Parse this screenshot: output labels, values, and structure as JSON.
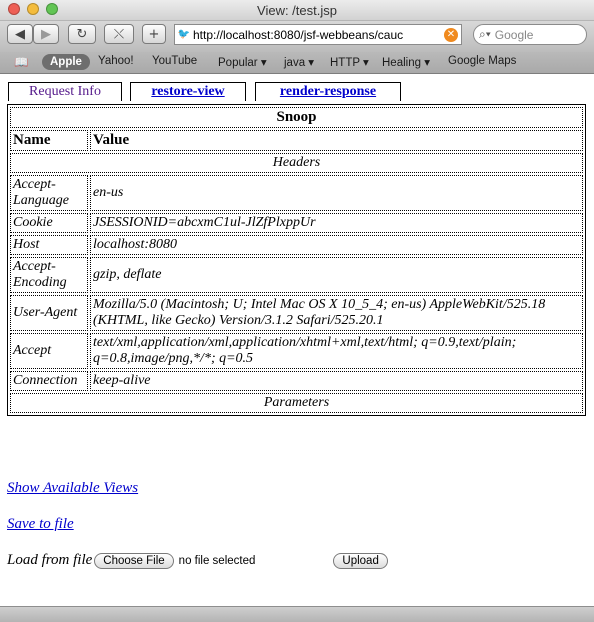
{
  "window": {
    "title": "View: /test.jsp"
  },
  "toolbar": {
    "back_icon": "back-icon",
    "forward_icon": "forward-icon",
    "url": "http://localhost:8080/jsf-webbeans/cauc",
    "search_placeholder": "Google"
  },
  "bookmarks": [
    {
      "label": "Apple"
    },
    {
      "label": "Yahoo!"
    },
    {
      "label": "YouTube"
    },
    {
      "label": "Popular ▾"
    },
    {
      "label": "java ▾"
    },
    {
      "label": "HTTP ▾"
    },
    {
      "label": "Healing ▾"
    },
    {
      "label": "Google Maps"
    }
  ],
  "tabs": [
    {
      "label": "Request Info"
    },
    {
      "label": "restore-view"
    },
    {
      "label": "render-response"
    }
  ],
  "snoop": {
    "title": "Snoop",
    "col_name": "Name",
    "col_value": "Value",
    "headers_label": "Headers",
    "parameters_label": "Parameters",
    "rows": [
      {
        "name": "Accept-Language",
        "value": "en-us"
      },
      {
        "name": "Cookie",
        "value": "JSESSIONID=abcxmC1ul-JlZfPlxppUr"
      },
      {
        "name": "Host",
        "value": "localhost:8080"
      },
      {
        "name": "Accept-Encoding",
        "value": "gzip, deflate"
      },
      {
        "name": "User-Agent",
        "value": "Mozilla/5.0 (Macintosh; U; Intel Mac OS X 10_5_4; en-us) AppleWebKit/525.18 (KHTML, like Gecko) Version/3.1.2 Safari/525.20.1"
      },
      {
        "name": "Accept",
        "value": "text/xml,application/xml,application/xhtml+xml,text/html; q=0.9,text/plain; q=0.8,image/png,*/*; q=0.5"
      },
      {
        "name": "Connection",
        "value": "keep-alive"
      }
    ]
  },
  "links": {
    "show_views": "Show Available Views",
    "save_file": "Save to file"
  },
  "load": {
    "label": "Load from file",
    "choose_button": "Choose File",
    "file_status": "no file selected",
    "upload_button": "Upload"
  }
}
